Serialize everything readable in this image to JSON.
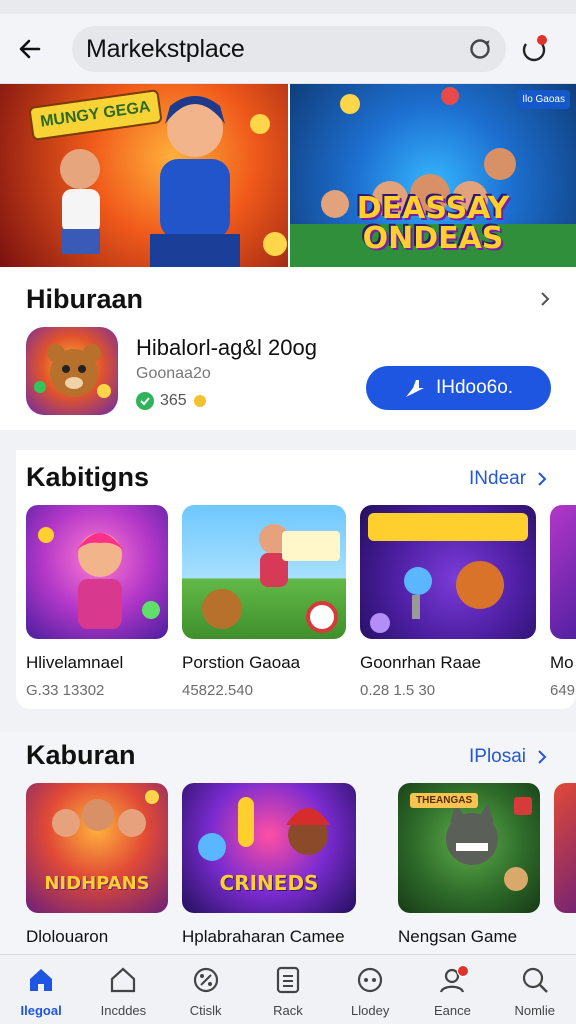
{
  "search": {
    "value": "Markekstplace"
  },
  "banners": {
    "sticker": "MUNGY GEGA",
    "tag": "Ilo Gaoas",
    "headline": "DEASSAY ONDEAS"
  },
  "featured": {
    "title": "Hiburaan",
    "app_name": "Hibalorl-ag&l 20og",
    "app_sub": "Goonaa2o",
    "rating": "365",
    "install_label": "IHdoo6o."
  },
  "section1": {
    "title": "Kabitigns",
    "see_all": "INdear",
    "items": [
      {
        "name": "Hlivelamnael",
        "meta": "G.33 13302"
      },
      {
        "name": "Porstion Gaoaa",
        "meta": "45822.540"
      },
      {
        "name": "Goonrhan Raae",
        "meta": "0.28 1.5 30"
      },
      {
        "name": "Mo",
        "meta": "649"
      }
    ]
  },
  "section2": {
    "title": "Kaburan",
    "see_all": "IPlosai",
    "items": [
      {
        "name": "Dlolouaron",
        "art": "NIDHPANS"
      },
      {
        "name": "Hplabraharan Camee",
        "art": "CRINEDS"
      },
      {
        "name": "Nengsan Game",
        "art": "THEANGAS"
      },
      {
        "name": "",
        "art": ""
      }
    ]
  },
  "nav": [
    {
      "label": "Ilegoal",
      "icon": "home-icon",
      "active": true
    },
    {
      "label": "Incddes",
      "icon": "house-outline-icon"
    },
    {
      "label": "Ctislk",
      "icon": "percent-tag-icon"
    },
    {
      "label": "Rack",
      "icon": "list-icon"
    },
    {
      "label": "Llodey",
      "icon": "gamepad-icon"
    },
    {
      "label": "Eance",
      "icon": "profile-icon",
      "badge": true
    },
    {
      "label": "Nomlie",
      "icon": "search-icon"
    }
  ],
  "colors": {
    "accent": "#1e55e1",
    "rating_green": "#2fb45a",
    "badge_red": "#e0312b"
  }
}
